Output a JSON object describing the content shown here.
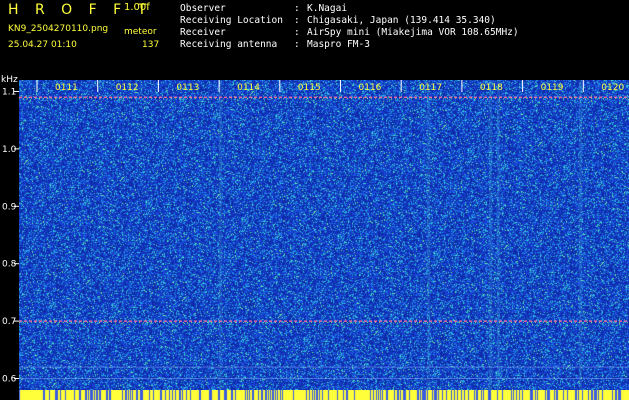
{
  "header": {
    "title": "H R O F F T",
    "version": "1.00f",
    "filename": "KN9_2504270110.png",
    "meteor_label": "meteor",
    "timestamp": "25.04.27 01:10",
    "meteor_count": "137"
  },
  "info": [
    {
      "key": "Observer",
      "colon": ":",
      "value": "K.Nagai"
    },
    {
      "key": "Receiving Location",
      "colon": ":",
      "value": "Chigasaki, Japan (139.414 35.340)"
    },
    {
      "key": "Receiver",
      "colon": ":",
      "value": "AirSpy mini (Miakejima VOR 108.65MHz)"
    },
    {
      "key": "Receiving antenna",
      "colon": ":",
      "value": "Maspro FM-3"
    }
  ],
  "chart_data": {
    "type": "heatmap",
    "ylabel": "kHz",
    "y_ticks": [
      "1.1",
      "1.0",
      "0.9",
      "0.8",
      "0.7",
      "0.6"
    ],
    "ylim": [
      0.58,
      1.12
    ],
    "x_ticks": [
      "0111",
      "0112",
      "0113",
      "0114",
      "0115",
      "0116",
      "0117",
      "0118",
      "0119",
      "0120"
    ],
    "horizontal_lines_khz": [
      1.09,
      0.7
    ],
    "colors": {
      "background": "#1a3bd6",
      "noise_low": "#0e2aa8",
      "noise_mid": "#1fb8e0",
      "noise_high": "#6df0a0",
      "line": "#ff70a0",
      "tick_label": "#ffff3a"
    }
  }
}
